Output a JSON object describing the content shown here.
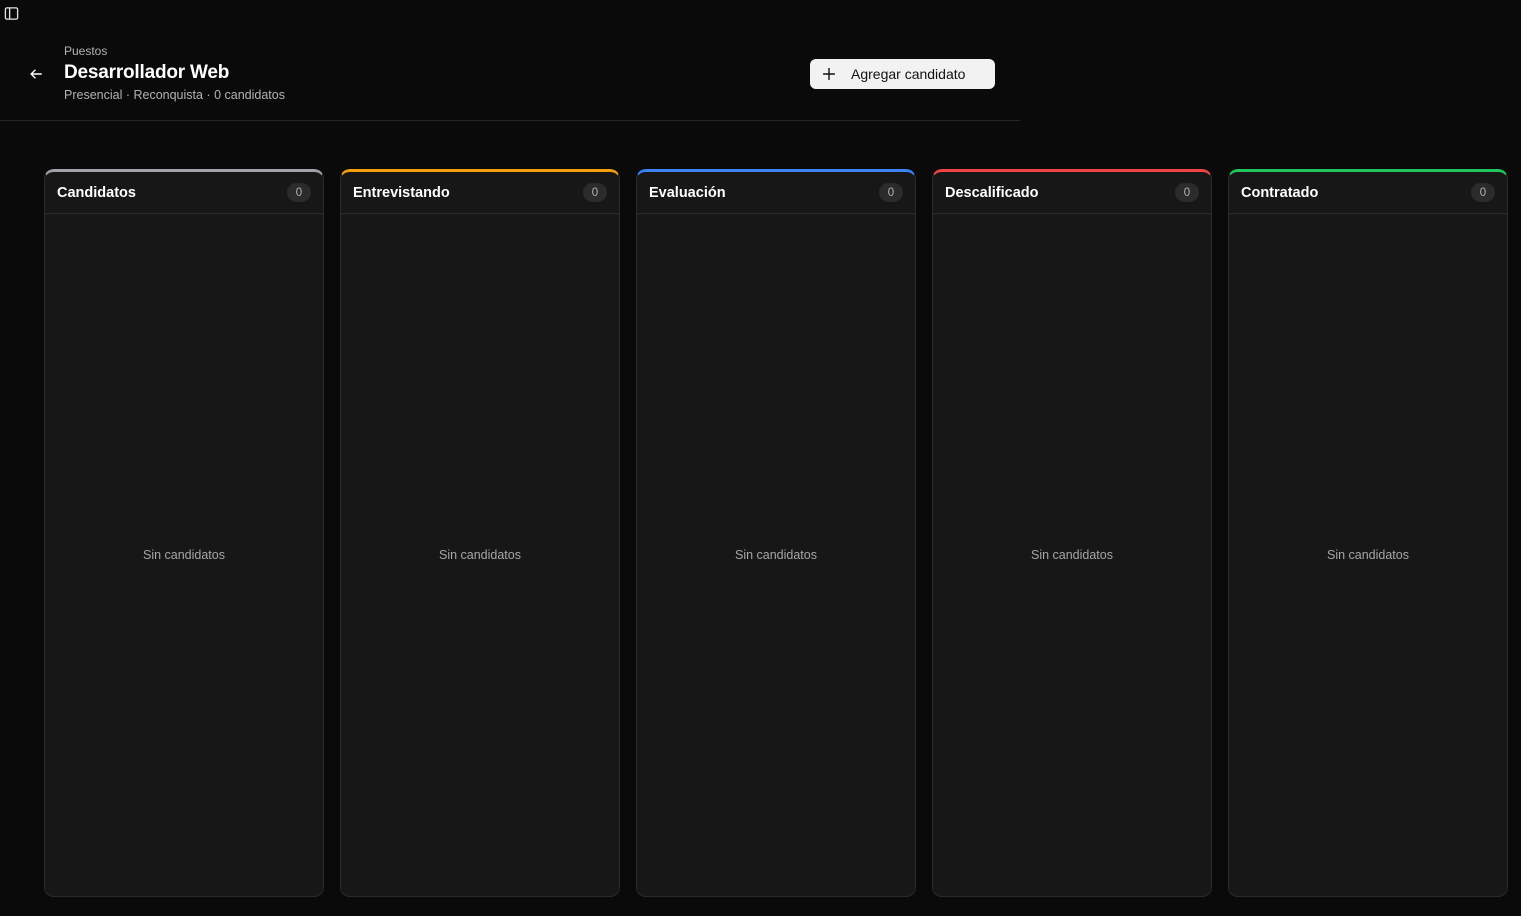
{
  "header": {
    "breadcrumb": "Puestos",
    "title": "Desarrollador Web",
    "subtitle": "Presencial · Reconquista · 0 candidatos",
    "add_button_label": "Agregar candidato"
  },
  "icons": {
    "sidebar_toggle": "sidebar-toggle-icon",
    "back": "arrow-left-icon",
    "add": "plus-icon"
  },
  "columns": [
    {
      "title": "Candidatos",
      "count": "0",
      "empty": "Sin candidatos",
      "accent": "#a1a1aa"
    },
    {
      "title": "Entrevistando",
      "count": "0",
      "empty": "Sin candidatos",
      "accent": "#f59e0b"
    },
    {
      "title": "Evaluación",
      "count": "0",
      "empty": "Sin candidatos",
      "accent": "#3b82f6"
    },
    {
      "title": "Descalificado",
      "count": "0",
      "empty": "Sin candidatos",
      "accent": "#ef4444"
    },
    {
      "title": "Contratado",
      "count": "0",
      "empty": "Sin candidatos",
      "accent": "#22c55e"
    }
  ]
}
